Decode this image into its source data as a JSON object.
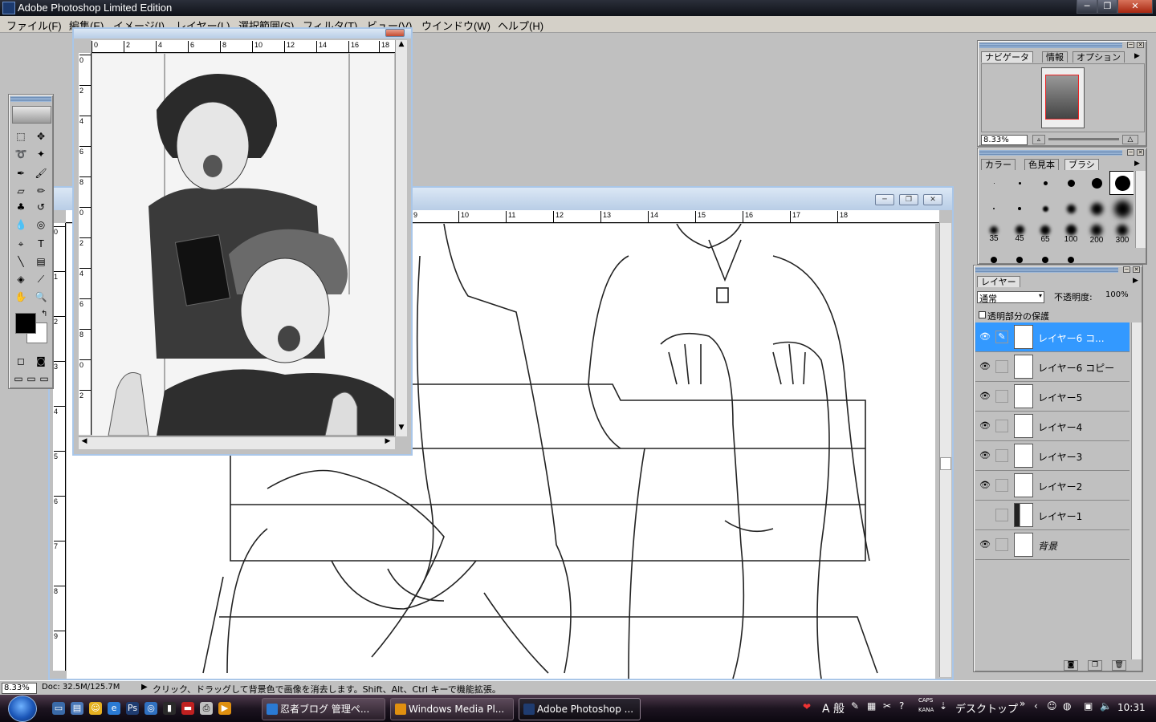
{
  "window": {
    "title": "Adobe Photoshop Limited Edition",
    "buttons": {
      "minimize": "─",
      "restore": "❐",
      "close": "✕"
    }
  },
  "menu": [
    "ファイル(F)",
    "編集(E)",
    "イメージ(I)",
    "レイヤー(L)",
    "選択範囲(S)",
    "フィルタ(T)",
    "ビュー(V)",
    "ウインドウ(W)",
    "ヘルプ(H)"
  ],
  "toolbox": {
    "tools": [
      "marquee-tool",
      "move-tool",
      "lasso-tool",
      "magic-wand-tool",
      "airbrush-tool",
      "paintbrush-tool",
      "eraser-tool",
      "pencil-tool",
      "clone-stamp-tool",
      "history-brush-tool",
      "blur-tool",
      "dodge-tool",
      "path-tool",
      "type-tool",
      "line-tool",
      "gradient-tool",
      "paint-bucket-tool",
      "eyedropper-tool",
      "hand-tool",
      "zoom-tool"
    ],
    "foreground_color": "#000000",
    "background_color": "#ffffff"
  },
  "small_doc": {
    "ruler_h": [
      "0",
      "2",
      "4",
      "6",
      "8",
      "10",
      "12",
      "14",
      "16",
      "18"
    ],
    "ruler_v": [
      "0",
      "2",
      "4",
      "6",
      "8",
      "0",
      "2",
      "4",
      "6",
      "8",
      "0",
      "2"
    ]
  },
  "main_doc": {
    "ruler_h": [
      "9",
      "10",
      "11",
      "12",
      "13",
      "14",
      "15",
      "16",
      "17",
      "18"
    ],
    "ruler_v": [
      "0",
      "1",
      "2",
      "3",
      "4",
      "5",
      "6",
      "7",
      "8",
      "9"
    ]
  },
  "navigator": {
    "tabs": [
      "ナビゲータ",
      "情報",
      "オプション"
    ],
    "zoom": "8.33%"
  },
  "brushes": {
    "tabs": [
      "カラー",
      "色見本",
      "ブラシ"
    ],
    "sizes": [
      "35",
      "45",
      "65",
      "100",
      "200",
      "300"
    ]
  },
  "layers": {
    "tab": "レイヤー",
    "blend_mode": "通常",
    "opacity_label": "不透明度:",
    "opacity_value": "100%",
    "preserve_transparency": "透明部分の保護",
    "items": [
      {
        "name": "レイヤー6 コ...",
        "visible": true,
        "active": true
      },
      {
        "name": "レイヤー6 コピー",
        "visible": true,
        "active": false
      },
      {
        "name": "レイヤー5",
        "visible": true,
        "active": false
      },
      {
        "name": "レイヤー4",
        "visible": true,
        "active": false
      },
      {
        "name": "レイヤー3",
        "visible": true,
        "active": false
      },
      {
        "name": "レイヤー2",
        "visible": true,
        "active": false
      },
      {
        "name": "レイヤー1",
        "visible": false,
        "active": false
      },
      {
        "name": "背景",
        "visible": true,
        "active": false
      }
    ]
  },
  "status": {
    "zoom": "8.33%",
    "doc": "Doc: 32.5M/125.7M",
    "hint": "クリック、ドラッグして背景色で画像を消去します。Shift、Alt、Ctrl キーで機能拡張。"
  },
  "taskbar": {
    "buttons": [
      "忍者ブログ 管理ペ...",
      "Windows Media Pl...",
      "Adobe Photoshop ..."
    ],
    "ime": "A 般",
    "caps": "CAPS",
    "kana": "KANA",
    "desktop": "デスクトップ",
    "time": "10:31"
  }
}
